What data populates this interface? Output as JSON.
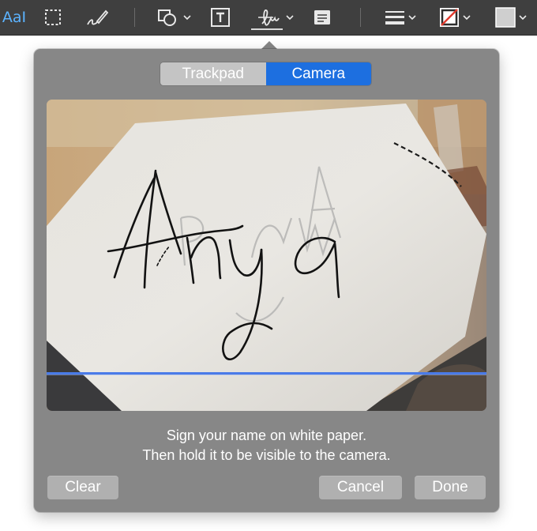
{
  "toolbar": {
    "text_style_label": "AaI",
    "tools": [
      {
        "name": "rectangular-selection-icon"
      },
      {
        "name": "sketch-icon"
      },
      {
        "name": "shapes-icon"
      },
      {
        "name": "text-box-icon"
      },
      {
        "name": "signature-icon"
      },
      {
        "name": "note-icon"
      },
      {
        "name": "line-style-icon"
      },
      {
        "name": "border-color-icon"
      },
      {
        "name": "fill-color-icon"
      }
    ],
    "accent_color": "#5cb3ff",
    "background_color": "#3f3f3f"
  },
  "signature_popover": {
    "tabs": [
      {
        "label": "Trackpad",
        "selected": false
      },
      {
        "label": "Camera",
        "selected": true
      }
    ],
    "selected_tab_color": "#1d6fe0",
    "camera_preview": {
      "signature_text": "Anya",
      "baseline_color": "#4a7be8"
    },
    "instructions": {
      "line1": "Sign your name on white paper.",
      "line2": "Then hold it to be visible to the camera."
    },
    "buttons": {
      "clear": "Clear",
      "cancel": "Cancel",
      "done": "Done"
    }
  }
}
